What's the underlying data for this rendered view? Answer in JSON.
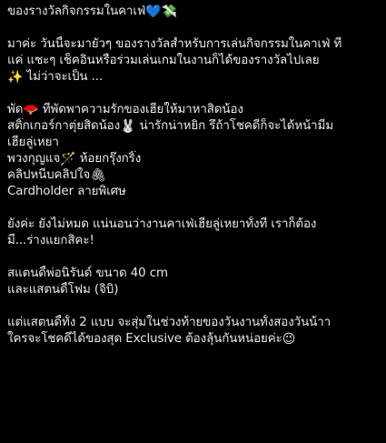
{
  "post": {
    "title": "ของรางวัลกิจกรรมในคาเฟ่",
    "title_emojis": "💙💸",
    "intro_line1": "มาค่ะ วันนี้จะมายั่วๆ ของรางวัลสำหรับการเล่นกิจกรรมในคาเฟ่ ที่",
    "intro_line2": "แค่ แชะๆ เช็คอินหรือร่วมเล่นเกมในงานก็ได้ของรางวัลไปเลย",
    "intro_emoji": "✨",
    "intro_line3": " ไม่ว่าจะเป็น ...",
    "fan_line": "พัด",
    "fan_emoji": "🪭",
    "fan_rest": " ที่พัดพาความรักของเฮียให้มาหาสิดน้อง",
    "sticker_line": "สติ๊กเกอร์กาตุ่ยสิดน้อง",
    "sticker_emoji": "🐰",
    "sticker_rest": " น่ารักน่าหยิก รึถ้าโชคดีก็จะได้หน้ามีม",
    "sticker_line2": "เฮียลู่เหยา",
    "keychain_line": "พวงกุญแจ",
    "keychain_emoji": "🪄",
    "keychain_rest": " ห้อยกรุ๊งกริ๊ง",
    "clip_line": "คลิปหนีบคลิปใจ",
    "clip_emoji": "🖇",
    "cardholder_line": "Cardholder ลายพิเศษ",
    "more_line1": "ยังค่ะ ยังไม่หมด แน่นอนว่างานคาเฟ่เฮียลู่เหยาทั้งที เราก็ต้อง",
    "more_line2": "มี...ร่างแยกสิคะ!",
    "standee_line1": "สแตนดี้พ่อนิรันด์ ขนาด 40 cm",
    "standee_line2": "และแสตนดี้โฟม (จิบิ)",
    "ending_line1": "แต่แสตนดี้ทั้ง 2 แบบ จะสุ่มในช่วงท้ายของวันงานทั้งสองวันน้าา",
    "ending_line2": "ใครจะโชคดีได้ของสุด Exclusive ต้องลุ้นกันหน่อยค่ะ",
    "ending_emoji": "😉"
  }
}
